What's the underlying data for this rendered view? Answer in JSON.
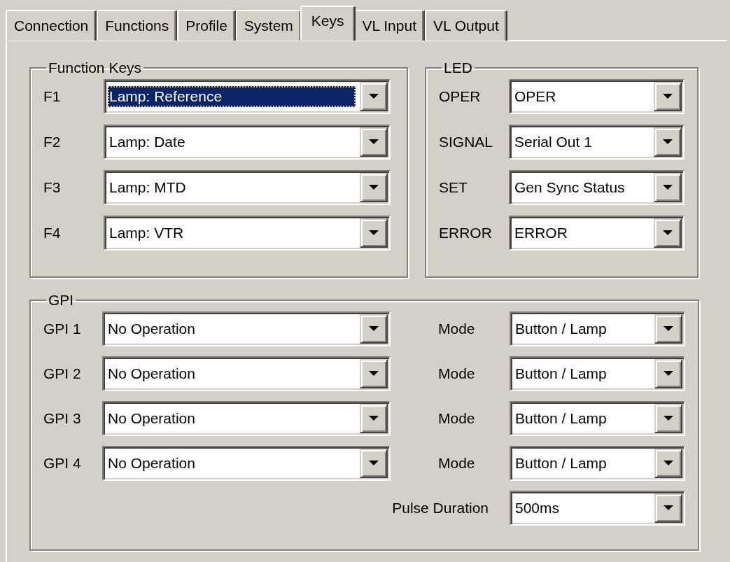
{
  "tabs": [
    {
      "label": "Connection",
      "selected": false
    },
    {
      "label": "Functions",
      "selected": false
    },
    {
      "label": "Profile",
      "selected": false
    },
    {
      "label": "System",
      "selected": false
    },
    {
      "label": "Keys",
      "selected": true
    },
    {
      "label": "VL Input",
      "selected": false
    },
    {
      "label": "VL Output",
      "selected": false
    }
  ],
  "function_keys": {
    "title": "Function Keys",
    "rows": [
      {
        "label": "F1",
        "value": "Lamp: Reference",
        "focused": true
      },
      {
        "label": "F2",
        "value": "Lamp: Date",
        "focused": false
      },
      {
        "label": "F3",
        "value": "Lamp: MTD",
        "focused": false
      },
      {
        "label": "F4",
        "value": "Lamp: VTR",
        "focused": false
      }
    ]
  },
  "led": {
    "title": "LED",
    "rows": [
      {
        "label": "OPER",
        "value": "OPER"
      },
      {
        "label": "SIGNAL",
        "value": "Serial Out 1"
      },
      {
        "label": "SET",
        "value": "Gen Sync Status"
      },
      {
        "label": "ERROR",
        "value": "ERROR"
      }
    ]
  },
  "gpi": {
    "title": "GPI",
    "rows": [
      {
        "label": "GPI 1",
        "value": "No Operation",
        "mode_label": "Mode",
        "mode_value": "Button / Lamp"
      },
      {
        "label": "GPI 2",
        "value": "No Operation",
        "mode_label": "Mode",
        "mode_value": "Button / Lamp"
      },
      {
        "label": "GPI 3",
        "value": "No Operation",
        "mode_label": "Mode",
        "mode_value": "Button / Lamp"
      },
      {
        "label": "GPI 4",
        "value": "No Operation",
        "mode_label": "Mode",
        "mode_value": "Button / Lamp"
      }
    ],
    "pulse": {
      "label": "Pulse Duration",
      "value": "500ms"
    }
  }
}
